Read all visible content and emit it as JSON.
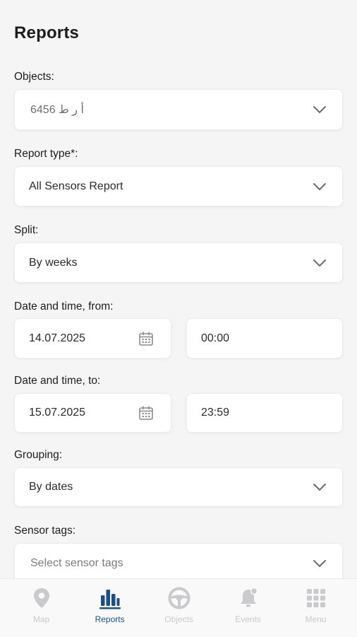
{
  "page": {
    "title": "Reports"
  },
  "form": {
    "objects": {
      "label": "Objects:",
      "value": "6456 أ ر ط"
    },
    "report_type": {
      "label": "Report type*:",
      "value": "All Sensors Report"
    },
    "split": {
      "label": "Split:",
      "value": "By weeks"
    },
    "date_from": {
      "label": "Date and time, from:",
      "date": "14.07.2025",
      "time": "00:00"
    },
    "date_to": {
      "label": "Date and time, to:",
      "date": "15.07.2025",
      "time": "23:59"
    },
    "grouping": {
      "label": "Grouping:",
      "value": "By dates"
    },
    "sensor_tags": {
      "label": "Sensor tags:",
      "placeholder": "Select sensor tags"
    }
  },
  "tabbar": {
    "items": [
      {
        "label": "Map",
        "icon": "map-pin-icon",
        "active": false
      },
      {
        "label": "Reports",
        "icon": "bar-chart-icon",
        "active": true
      },
      {
        "label": "Objects",
        "icon": "steering-wheel-icon",
        "active": false
      },
      {
        "label": "Events",
        "icon": "bell-icon",
        "active": false
      },
      {
        "label": "Menu",
        "icon": "grid-icon",
        "active": false
      }
    ]
  },
  "colors": {
    "background": "#f5f5f6",
    "active_tab": "#1d4f86",
    "inactive_tab": "#c9c9cc",
    "field_bg": "#ffffff"
  }
}
